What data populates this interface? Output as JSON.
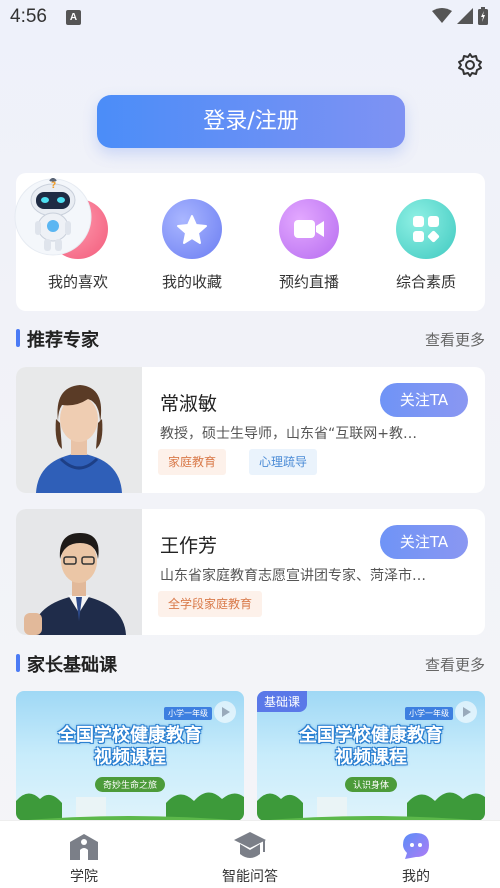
{
  "status_bar": {
    "time": "4:56",
    "notif_icon": "A"
  },
  "header": {
    "settings_icon": "gear-icon"
  },
  "login": {
    "label": "登录/注册"
  },
  "quick_actions": [
    {
      "label": "我的喜欢",
      "icon": "heart-icon",
      "color": "#f25a7a"
    },
    {
      "label": "我的收藏",
      "icon": "star-icon",
      "color": "#6b7df2"
    },
    {
      "label": "预约直播",
      "icon": "video-icon",
      "color": "#b66cf0"
    },
    {
      "label": "综合素质",
      "icon": "grid-icon",
      "color": "#3fc9c0"
    }
  ],
  "experts_section": {
    "title": "推荐专家",
    "more": "查看更多"
  },
  "experts": [
    {
      "name": "常淑敏",
      "follow": "关注TA",
      "desc": "教授，硕士生导师，山东省“互联网+教…",
      "tags": [
        "家庭教育",
        "心理疏导"
      ]
    },
    {
      "name": "王作芳",
      "follow": "关注TA",
      "desc": "山东省家庭教育志愿宣讲团专家、菏泽市…",
      "tags": [
        "全学段家庭教育"
      ]
    }
  ],
  "courses_section": {
    "title": "家长基础课",
    "more": "查看更多"
  },
  "courses": [
    {
      "title_line1": "全国学校健康教育",
      "title_line2": "视频课程",
      "subtitle": "奇妙生命之旅",
      "grade": "小学一年级",
      "badge": ""
    },
    {
      "title_line1": "全国学校健康教育",
      "title_line2": "视频课程",
      "subtitle": "认识身体",
      "grade": "小学一年级",
      "badge": "基础课"
    }
  ],
  "tabbar": [
    {
      "label": "学院",
      "icon": "academy-icon"
    },
    {
      "label": "智能问答",
      "icon": "graduation-cap-icon"
    },
    {
      "label": "我的",
      "icon": "chat-bubble-icon"
    }
  ]
}
